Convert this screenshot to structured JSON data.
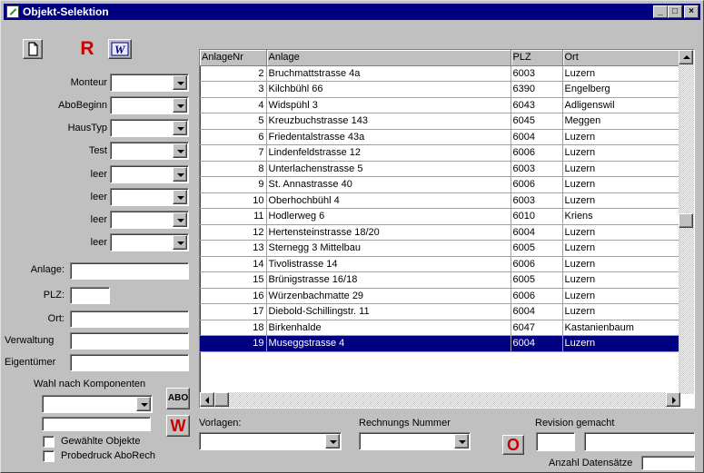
{
  "window": {
    "title": "Objekt-Selektion"
  },
  "toolbar": {
    "new_icon": "document-icon",
    "r_label": "R",
    "w_label": "W"
  },
  "filters": [
    {
      "label": "Monteur",
      "value": ""
    },
    {
      "label": "AboBeginn",
      "value": ""
    },
    {
      "label": "HausTyp",
      "value": ""
    },
    {
      "label": "Test",
      "value": ""
    },
    {
      "label": "leer",
      "value": ""
    },
    {
      "label": "leer",
      "value": ""
    },
    {
      "label": "leer",
      "value": ""
    },
    {
      "label": "leer",
      "value": ""
    }
  ],
  "fields": {
    "anlage_label": "Anlage:",
    "plz_label": "PLZ:",
    "ort_label": "Ort:",
    "verwaltung_label": "Verwaltung",
    "eigentuemer_label": "Eigentümer",
    "anlage_value": "",
    "plz_value": "",
    "ort_value": "",
    "verwaltung_value": "",
    "eigentuemer_value": ""
  },
  "komponenten": {
    "label": "Wahl nach Komponenten",
    "abo_button": "ABO",
    "w_button": "W",
    "select_value": "",
    "text_value": ""
  },
  "checkboxes": {
    "gewaehlte": "Gewählte Objekte",
    "probedruck": "Probedruck AboRech"
  },
  "grid": {
    "columns": [
      "AnlageNr",
      "Anlage",
      "PLZ",
      "Ort"
    ],
    "rows": [
      [
        "2",
        "Bruchmattstrasse 4a",
        "6003",
        "Luzern"
      ],
      [
        "3",
        "Kilchbühl 66",
        "6390",
        "Engelberg"
      ],
      [
        "4",
        "Widspühl 3",
        "6043",
        "Adligenswil"
      ],
      [
        "5",
        "Kreuzbuchstrasse 143",
        "6045",
        "Meggen"
      ],
      [
        "6",
        "Friedentalstrasse 43a",
        "6004",
        "Luzern"
      ],
      [
        "7",
        "Lindenfeldstrasse 12",
        "6006",
        "Luzern"
      ],
      [
        "8",
        "Unterlachenstrasse 5",
        "6003",
        "Luzern"
      ],
      [
        "9",
        "St. Annastrasse 40",
        "6006",
        "Luzern"
      ],
      [
        "10",
        "Oberhochbühl 4",
        "6003",
        "Luzern"
      ],
      [
        "11",
        "Hodlerweg 6",
        "6010",
        "Kriens"
      ],
      [
        "12",
        "Hertensteinstrasse 18/20",
        "6004",
        "Luzern"
      ],
      [
        "13",
        "Sternegg 3 Mittelbau",
        "6005",
        "Luzern"
      ],
      [
        "14",
        "Tivolistrasse 14",
        "6006",
        "Luzern"
      ],
      [
        "15",
        "Brünigstrasse 16/18",
        "6005",
        "Luzern"
      ],
      [
        "16",
        "Würzenbachmatte 29",
        "6006",
        "Luzern"
      ],
      [
        "17",
        "Diebold-Schillingstr. 11",
        "6004",
        "Luzern"
      ],
      [
        "18",
        "Birkenhalde",
        "6047",
        "Kastanienbaum"
      ],
      [
        "19",
        "Museggstrasse 4",
        "6004",
        "Luzern"
      ]
    ],
    "selected_row": 17
  },
  "bottom": {
    "vorlagen_label": "Vorlagen:",
    "rechnungs_label": "Rechnungs Nummer",
    "revision_label": "Revision gemacht",
    "o_button": "O",
    "anzahl_label": "Anzahl Datensätze",
    "vorlagen_value": "",
    "rechnungs_value": "",
    "revision_value1": "",
    "revision_value2": "",
    "anzahl_value": ""
  },
  "colors": {
    "title_bar": "#000080",
    "face": "#c0c0c0",
    "red": "#cc0000",
    "selection": "#000080"
  }
}
